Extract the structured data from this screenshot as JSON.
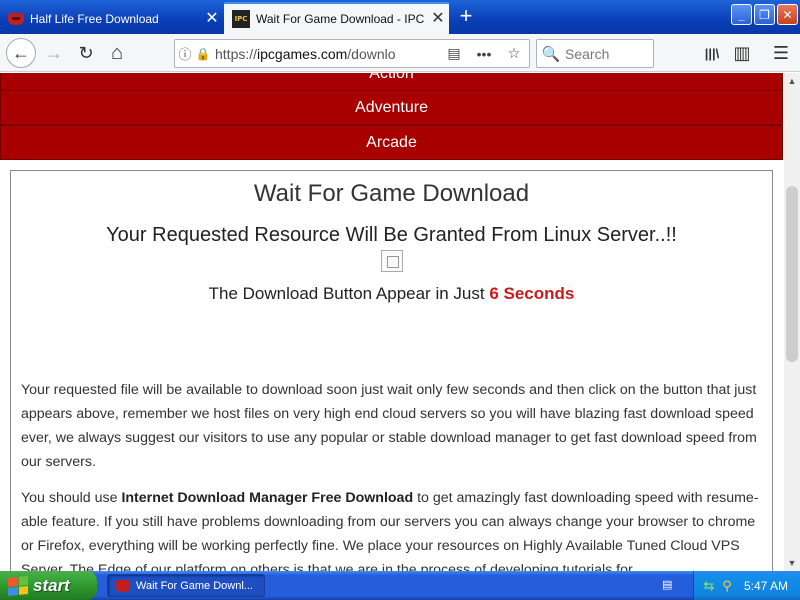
{
  "browser": {
    "tabs": [
      {
        "title": "Half Life Free Download",
        "active": false
      },
      {
        "title": "Wait For Game Download - IPC Ga",
        "active": true
      }
    ],
    "favicon_ipc_text": "IPC",
    "new_tab_glyph": "+",
    "window_buttons": {
      "minimize": "_",
      "maximize": "❐",
      "close": "✕"
    },
    "url": {
      "prefix": "https://",
      "host": "ipcgames.com",
      "path": "/downlo"
    },
    "search_placeholder": "Search",
    "icons": {
      "back": "←",
      "forward": "→",
      "reload": "↻",
      "home": "⌂",
      "info": "ⓘ",
      "lock": "🔒",
      "reader": "▤",
      "more": "•••",
      "star": "☆",
      "library": "|||\\",
      "sidebar": "▥",
      "menu": "☰",
      "search": "🔍"
    }
  },
  "page": {
    "categories": [
      "Action",
      "Adventure",
      "Arcade"
    ],
    "title": "Wait For Game Download",
    "subtitle": "Your Requested Resource Will Be Granted From Linux Server..!!",
    "countdown_prefix": "The Download Button Appear in Just ",
    "countdown_value": "6 Seconds",
    "paragraph1": "Your requested file will be available to download soon just wait only few seconds and then click on the button that just appears above, remember we host files on very high end cloud servers so you will have blazing fast download speed ever, we always suggest our visitors to use any popular or stable download manager to get fast download speed from our servers.",
    "paragraph2_pre": "You should use ",
    "paragraph2_bold": "Internet Download Manager Free Download",
    "paragraph2_post": " to get amazingly fast downloading speed with resume-able feature. If you still have problems downloading from our servers you can always change your browser to chrome or Firefox, everything will be working perfectly fine. We place your resources on Highly Available Tuned Cloud VPS Server. The Edge of our platform on others is that we are in the process of developing tutorials for"
  },
  "scrollbar": {
    "up": "▲",
    "down": "▼"
  },
  "taskbar": {
    "start_label": "start",
    "task_item": "Wait For Game Downl...",
    "clock": "5:47 AM"
  },
  "colors": {
    "category_bar": "#a80000",
    "countdown_accent": "#cc1a1a",
    "xp_blue": "#245edb",
    "start_green": "#2f9a2f"
  }
}
